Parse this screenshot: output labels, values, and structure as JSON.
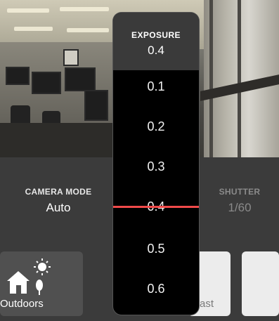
{
  "camera_mode": {
    "caption": "CAMERA MODE",
    "value": "Auto"
  },
  "shutter": {
    "caption": "SHUTTER",
    "value": "1/60"
  },
  "exposure": {
    "title": "EXPOSURE",
    "current": "0.4",
    "scale": [
      "0.1",
      "0.2",
      "0.3",
      "0.4",
      "0.5",
      "0.6"
    ],
    "indicator_color": "#f04a4a"
  },
  "presets": [
    {
      "label": "Outdoors",
      "icon": "house-sun-tree-icon"
    },
    {
      "label": "ast"
    },
    {
      "label": ""
    }
  ]
}
